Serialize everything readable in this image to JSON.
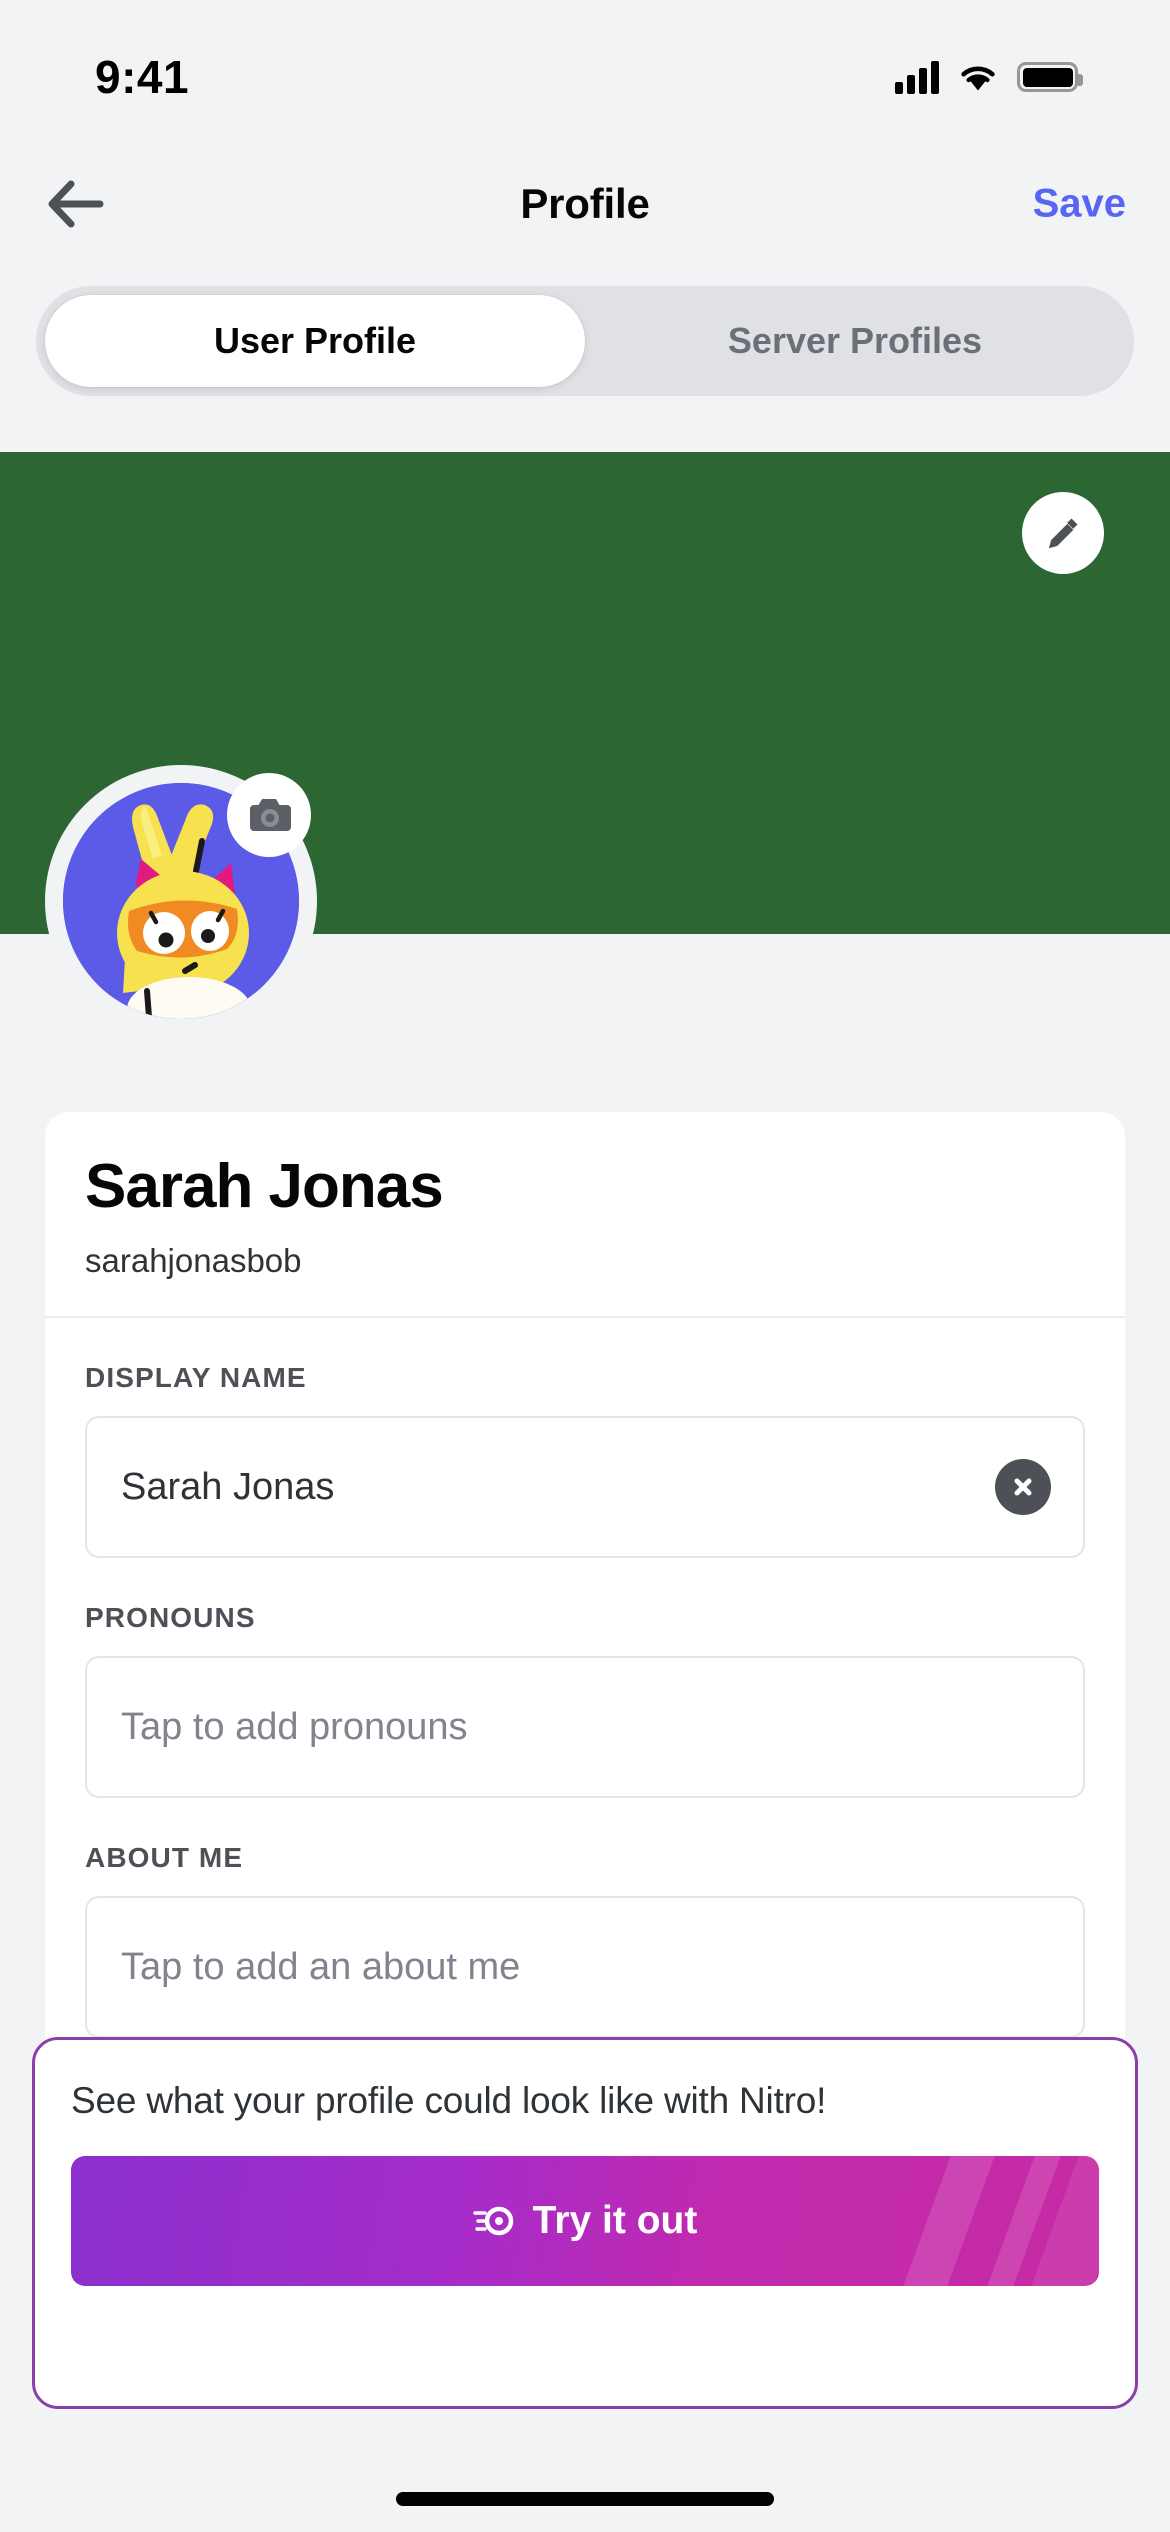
{
  "status_bar": {
    "time": "9:41",
    "icons": [
      "cellular-signal-icon",
      "wifi-icon",
      "battery-icon"
    ]
  },
  "nav": {
    "back_icon": "arrow-left-icon",
    "title": "Profile",
    "save_label": "Save",
    "save_color": "#5865F2"
  },
  "tabs": [
    {
      "label": "User Profile",
      "active": true
    },
    {
      "label": "Server Profiles",
      "active": false
    }
  ],
  "banner": {
    "color": "#2C6632",
    "edit_icon": "pencil-icon"
  },
  "avatar": {
    "background_color": "#5B5BE8",
    "edit_icon": "camera-icon",
    "alt": "yellow cartoon cat character with orange mask and pink ears"
  },
  "profile": {
    "display_name": "Sarah Jonas",
    "username": "sarahjonasbob"
  },
  "fields": [
    {
      "label": "DISPLAY NAME",
      "value": "Sarah Jonas",
      "placeholder": "",
      "is_placeholder": false,
      "has_clear": true,
      "clear_icon": "close-circle-icon"
    },
    {
      "label": "PRONOUNS",
      "value": "Tap to add pronouns",
      "placeholder": "Tap to add pronouns",
      "is_placeholder": true,
      "has_clear": false,
      "clear_icon": ""
    },
    {
      "label": "ABOUT ME",
      "value": "Tap to add an about me",
      "placeholder": "Tap to add an about me",
      "is_placeholder": true,
      "has_clear": false,
      "clear_icon": ""
    }
  ],
  "nitro_promo": {
    "message": "See what your profile could look like with Nitro!",
    "button_label": "Try it out",
    "button_icon": "nitro-boost-icon",
    "border_color": "#8B3FA8",
    "gradient_start": "#8B30CE",
    "gradient_end": "#C72AA3"
  }
}
